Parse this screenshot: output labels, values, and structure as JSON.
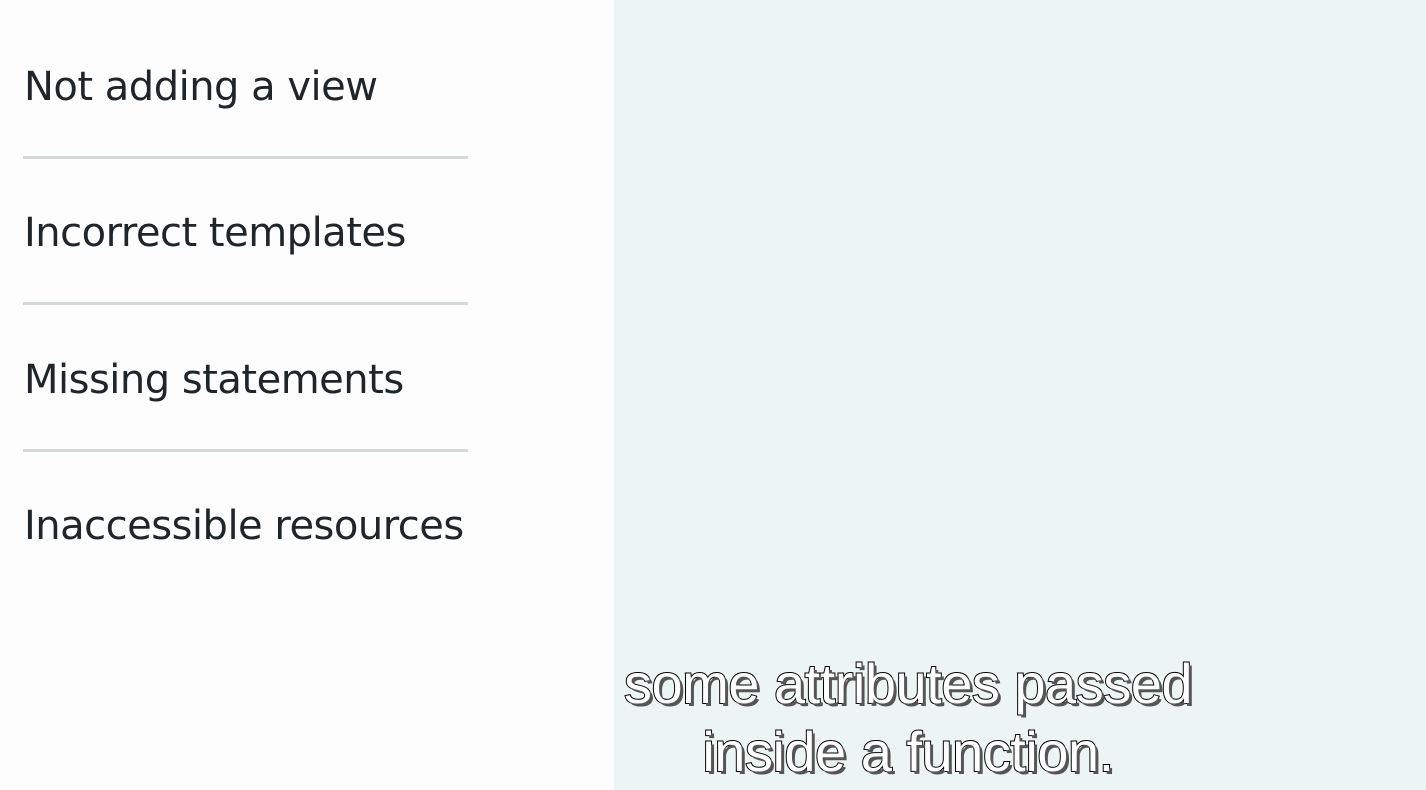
{
  "slide": {
    "items": [
      {
        "label": "Not adding a view"
      },
      {
        "label": "Incorrect templates"
      },
      {
        "label": "Missing statements"
      },
      {
        "label": "Inaccessible resources"
      }
    ]
  },
  "subtitle": {
    "lines": [
      "some attributes passed",
      "inside a function."
    ]
  },
  "colors": {
    "panel": "#edf5f4",
    "text": "#1f2529",
    "divider": "#d3d8da"
  }
}
